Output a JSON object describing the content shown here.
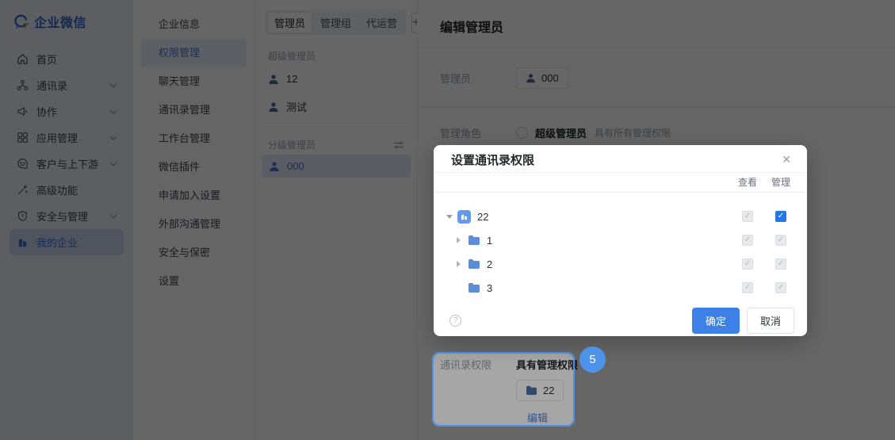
{
  "brand": {
    "name": "企业微信"
  },
  "sidebar": {
    "items": [
      {
        "label": "首页",
        "icon": "home-icon",
        "chevron": false,
        "active": false
      },
      {
        "label": "通讯录",
        "icon": "contacts-icon",
        "chevron": true,
        "active": false
      },
      {
        "label": "协作",
        "icon": "collaboration-icon",
        "chevron": true,
        "active": false
      },
      {
        "label": "应用管理",
        "icon": "apps-icon",
        "chevron": true,
        "active": false
      },
      {
        "label": "客户与上下游",
        "icon": "customers-icon",
        "chevron": true,
        "active": false
      },
      {
        "label": "高级功能",
        "icon": "advanced-icon",
        "chevron": false,
        "active": false
      },
      {
        "label": "安全与管理",
        "icon": "security-icon",
        "chevron": true,
        "active": false
      },
      {
        "label": "我的企业",
        "icon": "company-icon",
        "chevron": false,
        "active": true
      }
    ]
  },
  "settings_menu": {
    "items": [
      {
        "label": "企业信息",
        "active": false
      },
      {
        "label": "权限管理",
        "active": true
      },
      {
        "label": "聊天管理",
        "active": false
      },
      {
        "label": "通讯录管理",
        "active": false
      },
      {
        "label": "工作台管理",
        "active": false
      },
      {
        "label": "微信插件",
        "active": false
      },
      {
        "label": "申请加入设置",
        "active": false
      },
      {
        "label": "外部沟通管理",
        "active": false
      },
      {
        "label": "安全与保密",
        "active": false
      },
      {
        "label": "设置",
        "active": false
      }
    ]
  },
  "admin_panel": {
    "tabs": [
      {
        "label": "管理员",
        "active": true
      },
      {
        "label": "管理组",
        "active": false
      },
      {
        "label": "代运营",
        "active": false
      }
    ],
    "add_button": "+",
    "super_admin_title": "超级管理员",
    "super_admins": [
      {
        "name": "12"
      },
      {
        "name": "测试"
      }
    ],
    "sub_admin_title": "分级管理员",
    "sub_admins": [
      {
        "name": "000",
        "selected": true
      }
    ]
  },
  "editor": {
    "title": "编辑管理员",
    "admin_label": "管理员",
    "admin_name": "000",
    "role_label": "管理角色",
    "role_option": "超级管理员",
    "role_desc": "具有所有管理权限",
    "perm_label": "通讯录权限",
    "perm_value": "具有管理权限",
    "perm_scope": "22",
    "edit_link": "编辑"
  },
  "modal": {
    "title": "设置通讯录权限",
    "close_glyph": "✕",
    "columns": [
      "查看",
      "管理"
    ],
    "tree": [
      {
        "name": "22",
        "type": "company",
        "expanded": true,
        "view": "checked-disabled",
        "manage": "checked"
      },
      {
        "name": "1",
        "type": "folder",
        "expandable": true,
        "view": "checked-disabled",
        "manage": "checked-disabled"
      },
      {
        "name": "2",
        "type": "folder",
        "expandable": true,
        "view": "checked-disabled",
        "manage": "checked-disabled"
      },
      {
        "name": "3",
        "type": "folder",
        "expandable": false,
        "view": "checked-disabled",
        "manage": "checked-disabled"
      }
    ],
    "help_glyph": "?",
    "confirm_label": "确定",
    "cancel_label": "取消"
  },
  "annotation": {
    "step": "5"
  },
  "colors": {
    "accent": "#4a80e4",
    "primary_button": "#3d80e8",
    "checkbox_checked": "#2577e8",
    "badge": "#4e93ea",
    "highlight_border": "#4f92ea",
    "folder": "#5b8dd9",
    "sidebar_bg": "#e6eaf3"
  }
}
